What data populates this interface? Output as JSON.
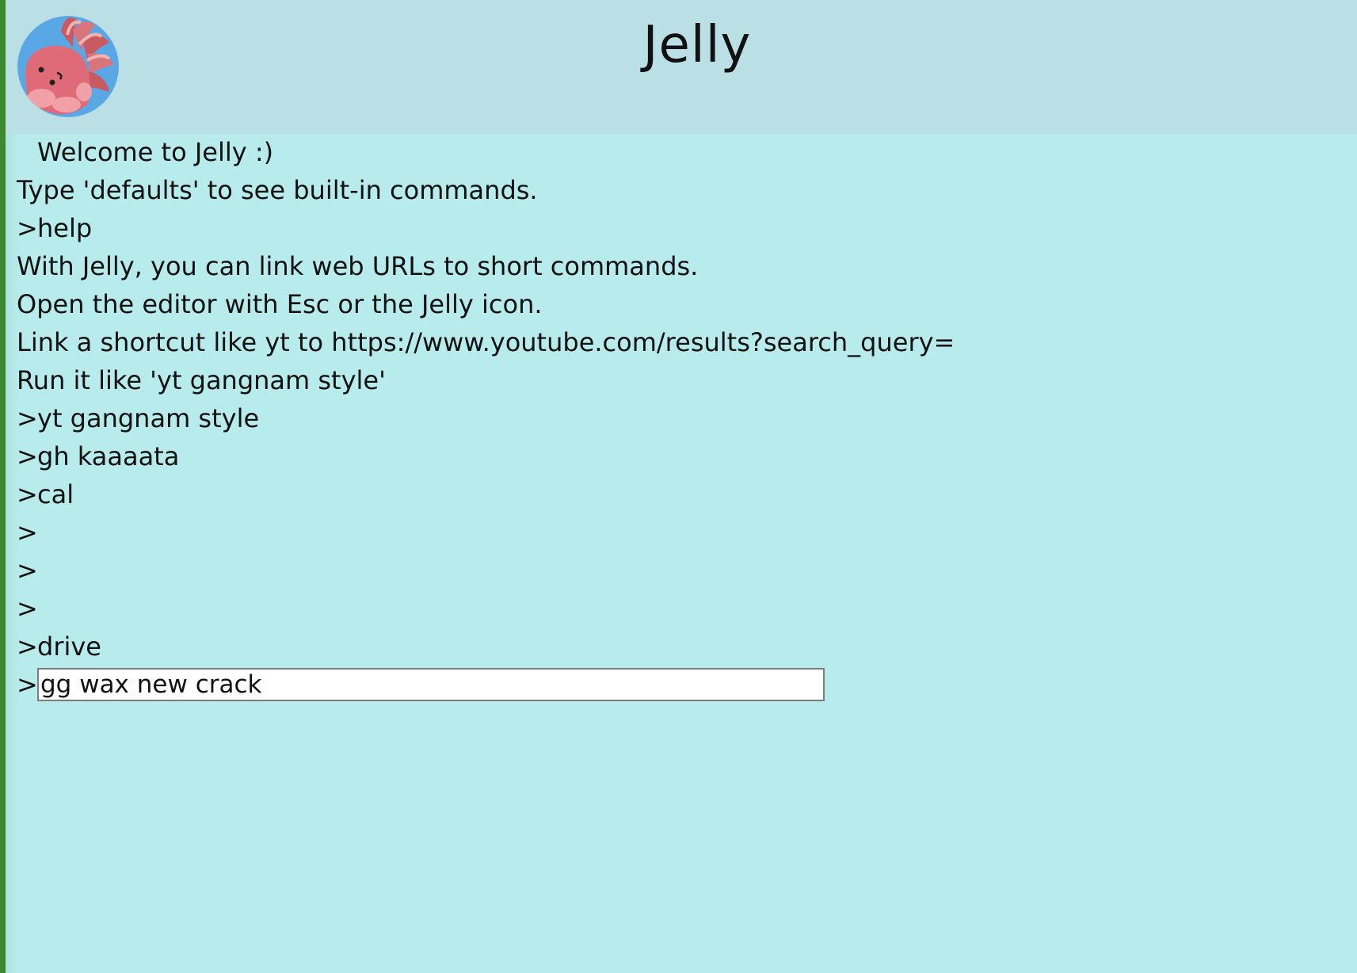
{
  "header": {
    "title": "Jelly",
    "logo_icon": "jellyfish-icon",
    "background_color": "#badfe5"
  },
  "console": {
    "background_color": "#b8ebeb",
    "prompt_symbol": ">",
    "lines": [
      {
        "prompt": "",
        "text": "Welcome to Jelly :)"
      },
      {
        "prompt": "",
        "text": "Type 'defaults' to see built-in commands."
      },
      {
        "prompt": ">",
        "text": "help"
      },
      {
        "prompt": "",
        "text": "With Jelly, you can link web URLs to short commands."
      },
      {
        "prompt": "",
        "text": "Open the editor with Esc or the Jelly icon."
      },
      {
        "prompt": "",
        "text": "Link a shortcut like yt to https://www.youtube.com/results?search_query="
      },
      {
        "prompt": "",
        "text": "Run it like 'yt gangnam style'"
      },
      {
        "prompt": ">",
        "text": "yt gangnam style"
      },
      {
        "prompt": ">",
        "text": "gh kaaaata"
      },
      {
        "prompt": ">",
        "text": "cal"
      },
      {
        "prompt": ">",
        "text": ""
      },
      {
        "prompt": ">",
        "text": ""
      },
      {
        "prompt": ">",
        "text": ""
      },
      {
        "prompt": ">",
        "text": "drive"
      }
    ],
    "input": {
      "prompt": ">",
      "value": "gg wax new crack"
    }
  }
}
